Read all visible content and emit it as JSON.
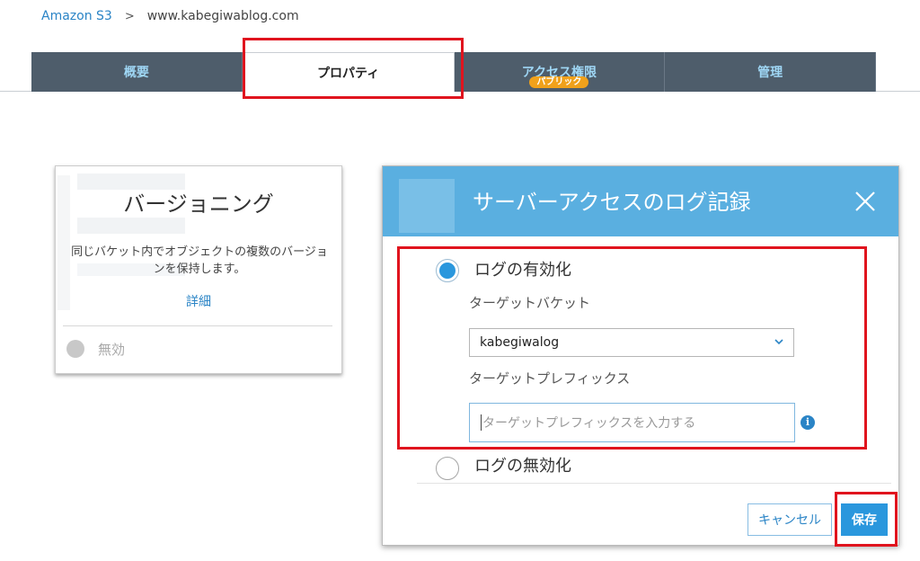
{
  "breadcrumb": {
    "root": "Amazon S3",
    "separator": ">",
    "current": "www.kabegiwablog.com"
  },
  "tabs": [
    {
      "label": "概要",
      "active": false
    },
    {
      "label": "プロパティ",
      "active": true
    },
    {
      "label": "アクセス権限",
      "active": false,
      "badge": "パブリック"
    },
    {
      "label": "管理",
      "active": false
    }
  ],
  "versioning": {
    "title": "バージョニング",
    "description": "同じバケット内でオブジェクトの複数のバージョンを保持します。",
    "details_link": "詳細",
    "status": "無効"
  },
  "modal": {
    "title": "サーバーアクセスのログ記録",
    "close_icon": "close-icon",
    "enable_option": "ログの有効化",
    "target_bucket_label": "ターゲットバケット",
    "target_bucket_value": "kabegiwalog",
    "target_prefix_label": "ターゲットプレフィックス",
    "target_prefix_placeholder": "ターゲットプレフィックスを入力する",
    "disable_option": "ログの無効化",
    "cancel_label": "キャンセル",
    "save_label": "保存"
  },
  "colors": {
    "tab_bg": "#4e5d6b",
    "tab_text": "#9fd7f5",
    "modal_header": "#5aafe0",
    "primary": "#2a97dd",
    "highlight": "#e0141e",
    "badge": "#f0a11b"
  }
}
